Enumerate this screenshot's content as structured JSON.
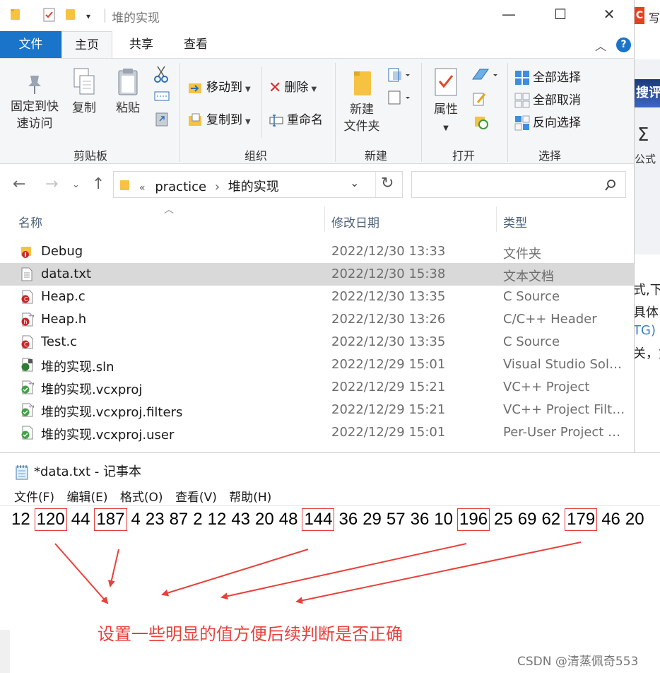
{
  "explorer": {
    "title": "堆的实现",
    "quick_access_icons": [
      "folder-icon",
      "properties-check-icon",
      "new-folder-icon",
      "dropdown-caret-icon"
    ],
    "tabs": [
      {
        "label": "文件",
        "active": false
      },
      {
        "label": "主页",
        "active": true
      },
      {
        "label": "共享",
        "active": false
      },
      {
        "label": "查看",
        "active": false
      }
    ],
    "help_label": "?",
    "ribbon": {
      "clipboard": {
        "group_label": "剪贴板",
        "pin_label_line1": "固定到快",
        "pin_label_line2": "速访问",
        "copy_label": "复制",
        "paste_label": "粘贴"
      },
      "organize": {
        "group_label": "组织",
        "move_to": "移动到",
        "copy_to": "复制到",
        "delete": "删除",
        "rename": "重命名"
      },
      "new": {
        "group_label": "新建",
        "new_folder_line1": "新建",
        "new_folder_line2": "文件夹"
      },
      "open": {
        "group_label": "打开",
        "properties": "属性"
      },
      "select": {
        "group_label": "选择",
        "select_all": "全部选择",
        "select_none": "全部取消",
        "invert": "反向选择"
      }
    },
    "address": {
      "prefix": "«",
      "crumbs": [
        "practice",
        "堆的实现"
      ],
      "separator": "›"
    },
    "columns": {
      "name": "名称",
      "date": "修改日期",
      "type": "类型"
    },
    "files": [
      {
        "name": "Debug",
        "date": "2022/12/30 13:33",
        "type": "文件夹",
        "icon": "folder-error-icon",
        "selected": false
      },
      {
        "name": "data.txt",
        "date": "2022/12/30 15:38",
        "type": "文本文档",
        "icon": "text-file-icon",
        "selected": true
      },
      {
        "name": "Heap.c",
        "date": "2022/12/30 13:35",
        "type": "C Source",
        "icon": "c-source-icon",
        "selected": false
      },
      {
        "name": "Heap.h",
        "date": "2022/12/30 13:26",
        "type": "C/C++ Header",
        "icon": "c-header-icon",
        "selected": false
      },
      {
        "name": "Test.c",
        "date": "2022/12/30 13:35",
        "type": "C Source",
        "icon": "c-source-icon",
        "selected": false
      },
      {
        "name": "堆的实现.sln",
        "date": "2022/12/29 15:01",
        "type": "Visual Studio Soluti...",
        "icon": "solution-icon",
        "selected": false
      },
      {
        "name": "堆的实现.vcxproj",
        "date": "2022/12/29 15:21",
        "type": "VC++ Project",
        "icon": "vcxproj-icon",
        "selected": false
      },
      {
        "name": "堆的实现.vcxproj.filters",
        "date": "2022/12/29 15:21",
        "type": "VC++ Project Filter...",
        "icon": "filters-icon",
        "selected": false
      },
      {
        "name": "堆的实现.vcxproj.user",
        "date": "2022/12/29 15:01",
        "type": "Per-User Project O...",
        "icon": "user-file-icon",
        "selected": false
      }
    ]
  },
  "background": {
    "xie": "写",
    "banner": "搜评",
    "sigma": "Σ",
    "gongshi": "公式",
    "fragments": [
      "式,下",
      "具体",
      "TG)",
      "关，如"
    ]
  },
  "notepad": {
    "title": "*data.txt - 记事本",
    "menu": [
      "文件(F)",
      "编辑(E)",
      "格式(O)",
      "查看(V)",
      "帮助(H)"
    ],
    "numbers": [
      {
        "v": "12",
        "boxed": false
      },
      {
        "v": "120",
        "boxed": true
      },
      {
        "v": "44",
        "boxed": false
      },
      {
        "v": "187",
        "boxed": true
      },
      {
        "v": "4",
        "boxed": false
      },
      {
        "v": "23",
        "boxed": false
      },
      {
        "v": "87",
        "boxed": false
      },
      {
        "v": "2",
        "boxed": false
      },
      {
        "v": "12",
        "boxed": false
      },
      {
        "v": "43",
        "boxed": false
      },
      {
        "v": "20",
        "boxed": false
      },
      {
        "v": "48",
        "boxed": false
      },
      {
        "v": "144",
        "boxed": true
      },
      {
        "v": "36",
        "boxed": false
      },
      {
        "v": "29",
        "boxed": false
      },
      {
        "v": "57",
        "boxed": false
      },
      {
        "v": "36",
        "boxed": false
      },
      {
        "v": "10",
        "boxed": false
      },
      {
        "v": "196",
        "boxed": true
      },
      {
        "v": "25",
        "boxed": false
      },
      {
        "v": "69",
        "boxed": false
      },
      {
        "v": "62",
        "boxed": false
      },
      {
        "v": "179",
        "boxed": true
      },
      {
        "v": "46",
        "boxed": false
      },
      {
        "v": "20",
        "boxed": false
      }
    ],
    "annotation": "设置一些明显的值方便后续判断是否正确",
    "annotation_color": "#e8413a",
    "watermark": "CSDN @清蒸佩奇553"
  },
  "colors": {
    "accent": "#1a74c9",
    "selection": "#d9d9d9",
    "ribbon_bg": "#f5f6f7"
  }
}
